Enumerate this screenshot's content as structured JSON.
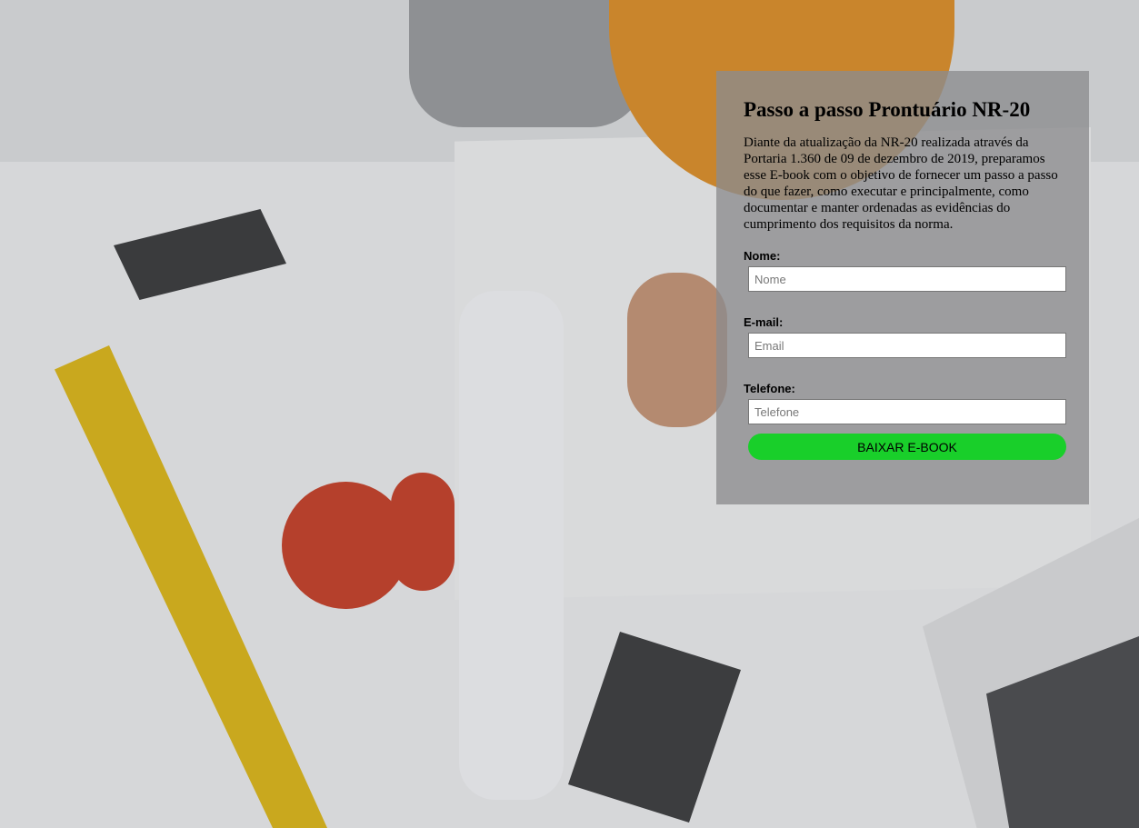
{
  "form": {
    "title": "Passo a passo Prontuário NR-20",
    "description": "Diante da atualização da NR-20 realizada através da Portaria 1.360 de 09 de dezembro de 2019, preparamos esse E-book com o objetivo de fornecer um passo a passo do que fazer, como executar e principalmente, como documentar e manter ordenadas as evidências do cumprimento dos requisitos da norma.",
    "fields": [
      {
        "label": "Nome:",
        "placeholder": "Nome",
        "value": ""
      },
      {
        "label": "E-mail:",
        "placeholder": "Email",
        "value": ""
      },
      {
        "label": "Telefone:",
        "placeholder": "Telefone",
        "value": ""
      }
    ],
    "submit_label": "BAIXAR E-BOOK",
    "submit_color": "#19cf2a"
  }
}
